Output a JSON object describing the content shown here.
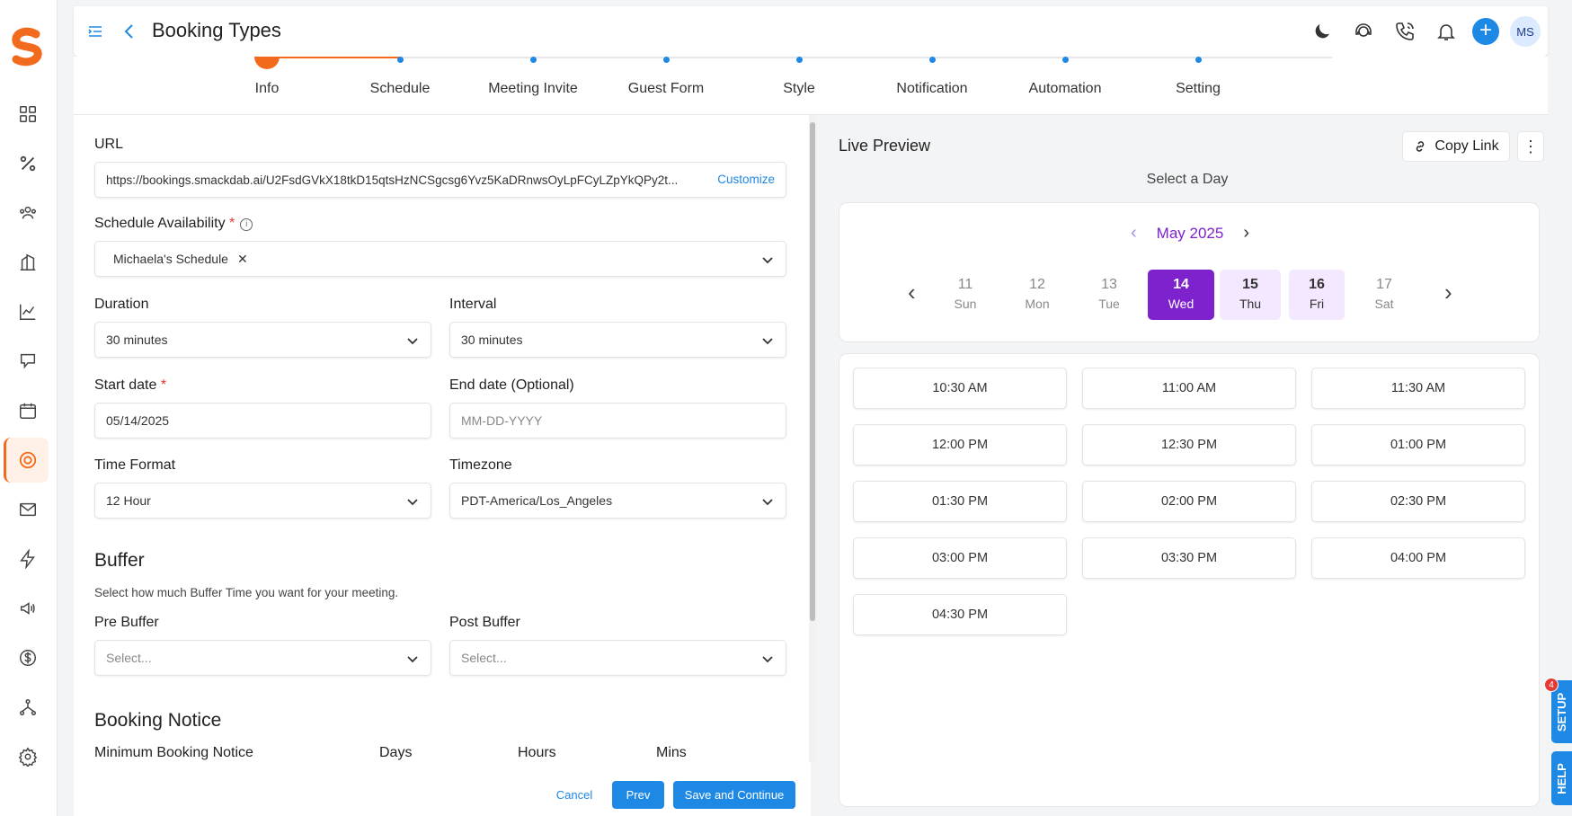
{
  "header": {
    "title": "Booking Types",
    "avatar_initials": "MS"
  },
  "steps": [
    {
      "label": "Info"
    },
    {
      "label": "Schedule"
    },
    {
      "label": "Meeting Invite"
    },
    {
      "label": "Guest Form"
    },
    {
      "label": "Style"
    },
    {
      "label": "Notification"
    },
    {
      "label": "Automation"
    },
    {
      "label": "Setting"
    }
  ],
  "form": {
    "url_label": "URL",
    "url_value": "https://bookings.smackdab.ai/U2FsdGVkX18tkD15qtsHzNCSgcsg6Yvz5KaDRnwsOyLpFCyLZpYkQPy2t...",
    "customize": "Customize",
    "schedule_label": "Schedule Availability",
    "schedule_value": "Michaela's Schedule",
    "duration_label": "Duration",
    "duration_value": "30 minutes",
    "interval_label": "Interval",
    "interval_value": "30 minutes",
    "start_label": "Start date",
    "start_value": "05/14/2025",
    "end_label": "End date  (Optional)",
    "end_placeholder": "MM-DD-YYYY",
    "time_format_label": "Time Format",
    "time_format_value": "12 Hour",
    "timezone_label": "Timezone",
    "timezone_value": "PDT-America/Los_Angeles",
    "buffer_title": "Buffer",
    "buffer_hint": "Select how much Buffer Time you want for your meeting.",
    "pre_buffer_label": "Pre Buffer",
    "pre_buffer_placeholder": "Select...",
    "post_buffer_label": "Post Buffer",
    "post_buffer_placeholder": "Select...",
    "notice_title": "Booking Notice",
    "min_notice_label": "Minimum Booking Notice",
    "days_label": "Days",
    "hours_label": "Hours",
    "mins_label": "Mins",
    "cancel": "Cancel",
    "prev": "Prev",
    "save": "Save and Continue"
  },
  "preview": {
    "title": "Live Preview",
    "copy_link": "Copy Link",
    "select_day": "Select a Day",
    "month": "May 2025",
    "days": [
      {
        "num": "11",
        "dow": "Sun",
        "state": "off"
      },
      {
        "num": "12",
        "dow": "Mon",
        "state": "off"
      },
      {
        "num": "13",
        "dow": "Tue",
        "state": "off"
      },
      {
        "num": "14",
        "dow": "Wed",
        "state": "active"
      },
      {
        "num": "15",
        "dow": "Thu",
        "state": "avail"
      },
      {
        "num": "16",
        "dow": "Fri",
        "state": "avail"
      },
      {
        "num": "17",
        "dow": "Sat",
        "state": "off"
      }
    ],
    "slots": [
      "10:30 AM",
      "11:00 AM",
      "11:30 AM",
      "12:00 PM",
      "12:30 PM",
      "01:00 PM",
      "01:30 PM",
      "02:00 PM",
      "02:30 PM",
      "03:00 PM",
      "03:30 PM",
      "04:00 PM",
      "04:30 PM"
    ]
  },
  "side_tabs": {
    "setup": "SETUP",
    "help": "HELP",
    "setup_badge": "4"
  },
  "colors": {
    "brand": "#f26b1d",
    "primary": "#1e88e5",
    "accent": "#7e22ce"
  }
}
